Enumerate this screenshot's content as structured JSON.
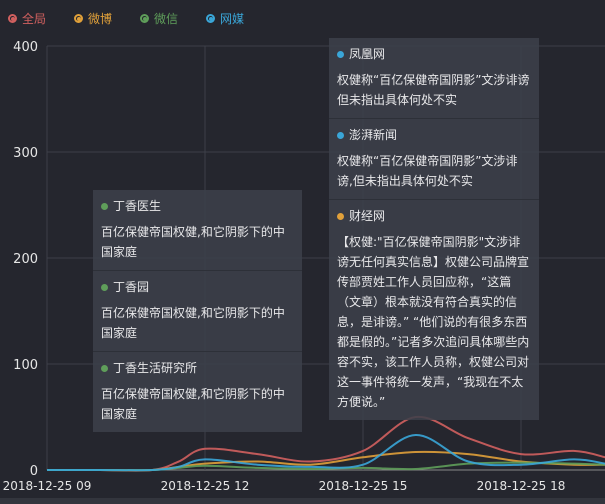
{
  "legend": [
    {
      "name": "全局",
      "color": "#d1605f"
    },
    {
      "name": "微博",
      "color": "#e0a03a"
    },
    {
      "name": "微信",
      "color": "#5f9e5a"
    },
    {
      "name": "网媒",
      "color": "#3aa6d8"
    }
  ],
  "tooltips_left": [
    {
      "source": "丁香医生",
      "color": "#5f9e5a",
      "text": "百亿保健帝国权健,和它阴影下的中国家庭"
    },
    {
      "source": "丁香园",
      "color": "#5f9e5a",
      "text": "百亿保健帝国权健,和它阴影下的中国家庭"
    },
    {
      "source": "丁香生活研究所",
      "color": "#5f9e5a",
      "text": "百亿保健帝国权健,和它阴影下的中国家庭"
    }
  ],
  "tooltips_right": [
    {
      "source": "凤凰网",
      "color": "#3aa6d8",
      "text": "权健称“百亿保健帝国阴影”文涉诽谤 但未指出具体何处不实"
    },
    {
      "source": "澎湃新闻",
      "color": "#3aa6d8",
      "text": "权健称“百亿保健帝国阴影”文涉诽谤,但未指出具体何处不实"
    },
    {
      "source": "财经网",
      "color": "#e0a03a",
      "text": "【权健:\"百亿保健帝国阴影\"文涉诽谤无任何真实信息】权健公司品牌宣传部贾姓工作人员回应称，“这篇（文章）根本就没有符合真实的信息，是诽谤。” “他们说的有很多东西都是假的。”记者多次追问具体哪些内容不实，该工作人员称，权健公司对这一事件将统一发声，“我现在不太方便说。”"
    }
  ],
  "chart_data": {
    "type": "line",
    "title": "",
    "xlabel": "",
    "ylabel": "",
    "ylim": [
      0,
      400
    ],
    "yticks": [
      "0",
      "100",
      "200",
      "300",
      "400"
    ],
    "xticks": [
      {
        "x": 9,
        "label": "2018-12-25 09"
      },
      {
        "x": 12,
        "label": "2018-12-25 12"
      },
      {
        "x": 15,
        "label": "2018-12-25 15"
      },
      {
        "x": 18,
        "label": "2018-12-25 18"
      }
    ],
    "x": [
      9,
      10,
      11,
      11.5,
      12,
      13,
      14,
      15,
      16,
      17,
      18,
      19,
      19.6
    ],
    "series": [
      {
        "name": "全局",
        "values": [
          0,
          0,
          0,
          8,
          20,
          15,
          8,
          18,
          50,
          30,
          15,
          18,
          12
        ]
      },
      {
        "name": "微博",
        "values": [
          0,
          0,
          0,
          3,
          6,
          8,
          5,
          12,
          17,
          15,
          8,
          5,
          5
        ]
      },
      {
        "name": "微信",
        "values": [
          0,
          0,
          0,
          2,
          4,
          2,
          1,
          2,
          1,
          6,
          7,
          6,
          5
        ]
      },
      {
        "name": "网媒",
        "values": [
          0,
          0,
          0,
          3,
          10,
          5,
          3,
          5,
          33,
          8,
          5,
          10,
          6
        ]
      }
    ],
    "grid": true,
    "legend_position": "top-left"
  }
}
